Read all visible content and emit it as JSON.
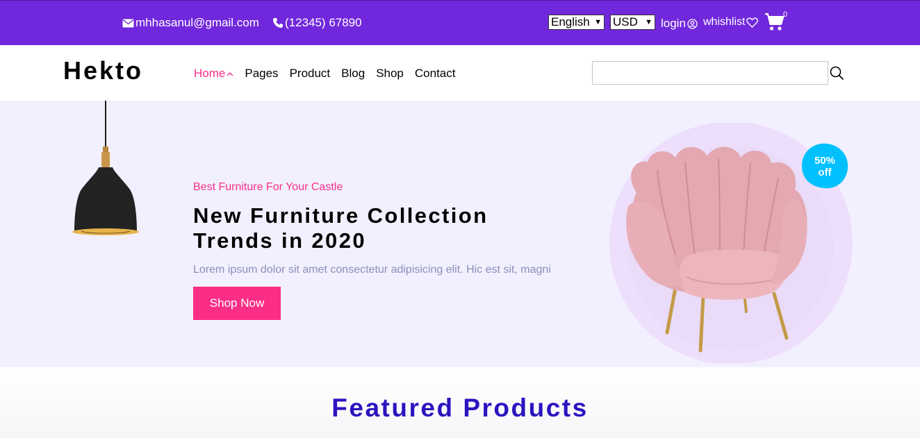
{
  "topbar": {
    "email": "mhhasanul@gmail.com",
    "phone": "(12345) 67890",
    "language": "English",
    "currency": "USD",
    "login": "login",
    "wishlist": "whishlist",
    "cart_count": "0",
    "bg_color": "#7128dc"
  },
  "nav": {
    "logo": "Hekto",
    "items": [
      "Home",
      "Pages",
      "Product",
      "Blog",
      "Shop",
      "Contact"
    ],
    "active_item": "Home",
    "search_value": "",
    "accent_color": "#fb2e86"
  },
  "hero": {
    "subtitle": "Best Furniture For Your Castle",
    "title_line1": "New Furniture Collection",
    "title_line2": "Trends in 2020",
    "description": "Lorem ipsum dolor sit amet consectetur adipisicing elit. Hic est sit, magni",
    "button": "Shop Now",
    "badge_line1": "50%",
    "badge_line2": "off",
    "bg_color": "#f2f0ff"
  },
  "featured": {
    "title": "Featured Products",
    "color": "#2b14c0"
  }
}
